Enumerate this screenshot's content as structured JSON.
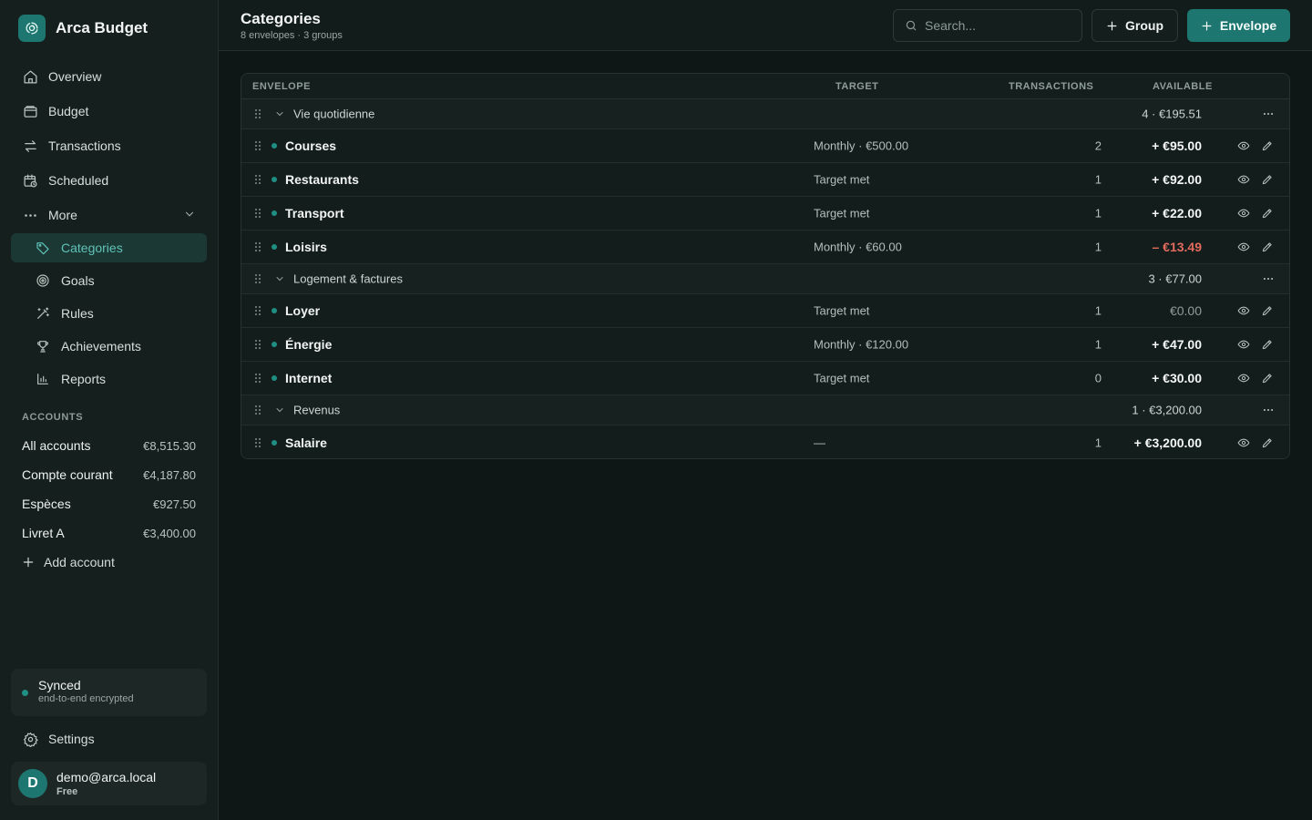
{
  "app": {
    "name": "Arca Budget",
    "logo_icon": "fingerprint-icon"
  },
  "nav": {
    "overview": "Overview",
    "budget": "Budget",
    "transactions": "Transactions",
    "scheduled": "Scheduled",
    "more": "More",
    "categories": "Categories",
    "goals": "Goals",
    "rules": "Rules",
    "achievements": "Achievements",
    "reports": "Reports",
    "active": "Categories"
  },
  "accounts": {
    "heading": "ACCOUNTS",
    "items": [
      {
        "name": "All accounts",
        "amount": "€8,515.30"
      },
      {
        "name": "Compte courant",
        "amount": "€4,187.80"
      },
      {
        "name": "Espèces",
        "amount": "€927.50"
      },
      {
        "name": "Livret A",
        "amount": "€3,400.00"
      }
    ],
    "add_label": "Add account"
  },
  "sync": {
    "title": "Synced",
    "subtitle": "end-to-end encrypted"
  },
  "settings_label": "Settings",
  "user": {
    "initial": "D",
    "email": "demo@arca.local",
    "plan": "Free"
  },
  "header": {
    "title": "Categories",
    "subtitle": "8 envelopes · 3 groups",
    "search_placeholder": "Search...",
    "group_button": "Group",
    "envelope_button": "Envelope"
  },
  "table": {
    "columns": {
      "envelope": "ENVELOPE",
      "target": "TARGET",
      "transactions": "TRANSACTIONS",
      "available": "AVAILABLE"
    },
    "groups": [
      {
        "name": "Vie quotidienne",
        "total": "4 · €195.51",
        "envelopes": [
          {
            "name": "Courses",
            "target": "Monthly · €500.00",
            "transactions": "2",
            "available": "+ €95.00",
            "state": "pos"
          },
          {
            "name": "Restaurants",
            "target": "Target met",
            "transactions": "1",
            "available": "+ €92.00",
            "state": "pos"
          },
          {
            "name": "Transport",
            "target": "Target met",
            "transactions": "1",
            "available": "+ €22.00",
            "state": "pos"
          },
          {
            "name": "Loisirs",
            "target": "Monthly · €60.00",
            "transactions": "1",
            "available": "– €13.49",
            "state": "neg"
          }
        ]
      },
      {
        "name": "Logement & factures",
        "total": "3 · €77.00",
        "envelopes": [
          {
            "name": "Loyer",
            "target": "Target met",
            "transactions": "1",
            "available": "€0.00",
            "state": "zero"
          },
          {
            "name": "Énergie",
            "target": "Monthly · €120.00",
            "transactions": "1",
            "available": "+ €47.00",
            "state": "pos"
          },
          {
            "name": "Internet",
            "target": "Target met",
            "transactions": "0",
            "available": "+ €30.00",
            "state": "pos"
          }
        ]
      },
      {
        "name": "Revenus",
        "total": "1 · €3,200.00",
        "envelopes": [
          {
            "name": "Salaire",
            "target": "—",
            "transactions": "1",
            "available": "+ €3,200.00",
            "state": "pos"
          }
        ]
      }
    ]
  },
  "colors": {
    "accent": "#1d766f",
    "negative": "#e26b5e",
    "active_nav": "#5fc3b8"
  }
}
